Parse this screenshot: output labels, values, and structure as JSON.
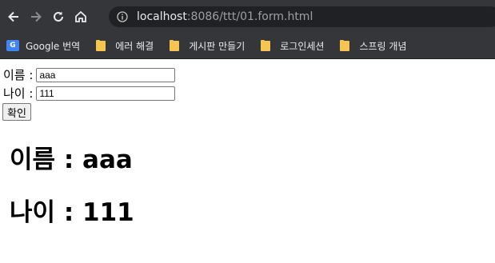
{
  "browser": {
    "url_host": "localhost",
    "url_rest": ":8086/ttt/01.form.html",
    "bookmarks": [
      {
        "label": "Google 번역",
        "icon": "google-translate-icon"
      },
      {
        "label": "에러 해결",
        "icon": "folder-icon"
      },
      {
        "label": "게시판 만들기",
        "icon": "folder-icon"
      },
      {
        "label": "로그인세션",
        "icon": "folder-icon"
      },
      {
        "label": "스프링 개념",
        "icon": "folder-icon"
      }
    ]
  },
  "form": {
    "name_label": "이름 :",
    "name_value": "aaa",
    "age_label": "나이 :",
    "age_value": "111",
    "submit_label": "확인"
  },
  "result": {
    "name_line": "이름 : aaa",
    "age_line": "나이 : 111"
  }
}
